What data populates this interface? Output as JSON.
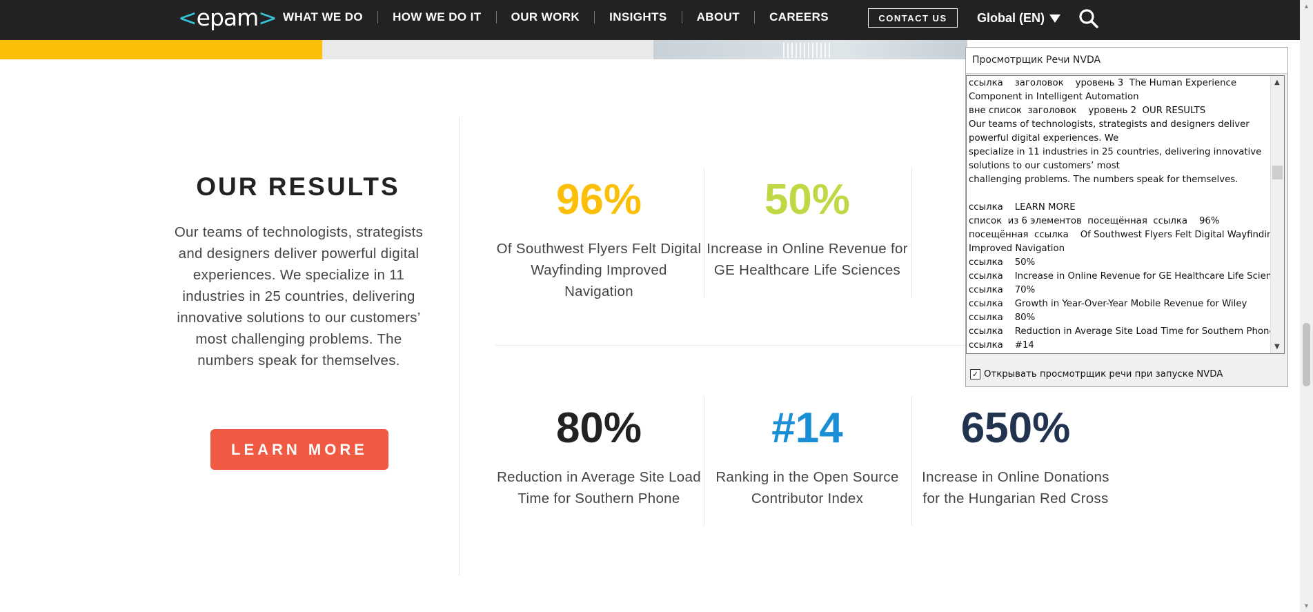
{
  "header": {
    "logo": {
      "left": "<",
      "text": "epam",
      "right": ">"
    },
    "nav": [
      "WHAT WE DO",
      "HOW WE DO IT",
      "OUR WORK",
      "INSIGHTS",
      "ABOUT",
      "CAREERS"
    ],
    "contact_label": "CONTACT US",
    "region_label": "Global (EN)",
    "search_icon": "search-icon"
  },
  "section": {
    "title": "OUR RESULTS",
    "description": "Our teams of technologists, strategists and designers deliver powerful digital experiences. We specialize in 11 industries in 25 countries, delivering innovative solutions to our customers’ most challenging problems. The numbers speak for themselves.",
    "cta": "LEARN MORE",
    "cta_color": "#f05a43"
  },
  "stats": [
    {
      "value": "96%",
      "label": "Of Southwest Flyers Felt Digital Wayfinding Improved Navigation",
      "color": "#fbbf0a"
    },
    {
      "value": "50%",
      "label": "Increase in Online Revenue for GE Healthcare Life Sciences",
      "color": "#c1d844"
    },
    {
      "value": "",
      "label": "Grow… Mobil…",
      "color": "#222222"
    },
    {
      "value": "80%",
      "label": "Reduction in Average Site Load Time for Southern Phone",
      "color": "#222222"
    },
    {
      "value": "#14",
      "label": "Ranking in the Open Source Contributor Index",
      "color": "#1a8fd6"
    },
    {
      "value": "650%",
      "label": "Increase in Online Donations for the Hungarian Red Cross",
      "color": "#223350"
    }
  ],
  "nvda": {
    "title": "Просмотрщик Речи NVDA",
    "lines": [
      "ссылка    заголовок    уровень 3  The Human Experience",
      "Component in Intelligent Automation",
      "вне список  заголовок    уровень 2  OUR RESULTS",
      "Our teams of technologists, strategists and designers deliver",
      "powerful digital experiences. We",
      "specialize in 11 industries in 25 countries, delivering innovative",
      "solutions to our customers’ most",
      "challenging problems. The numbers speak for themselves.",
      "",
      "ссылка    LEARN MORE",
      "список  из 6 элементов  посещённая  ссылка    96%",
      "посещённая  ссылка    Of Southwest Flyers Felt Digital Wayfinding",
      "Improved Navigation",
      "ссылка    50%",
      "ссылка    Increase in Online Revenue for GE Healthcare Life Sciences",
      "ссылка    70%",
      "ссылка    Growth in Year-Over-Year Mobile Revenue for Wiley",
      "ссылка    80%",
      "ссылка    Reduction in Average Site Load Time for Southern Phone",
      "ссылка    #14",
      "ссылка    Ranking in the Open Source Contributor Index"
    ],
    "checkbox_label": "Открывать просмотрщик речи при запуске NVDA",
    "checkbox_checked": true
  }
}
